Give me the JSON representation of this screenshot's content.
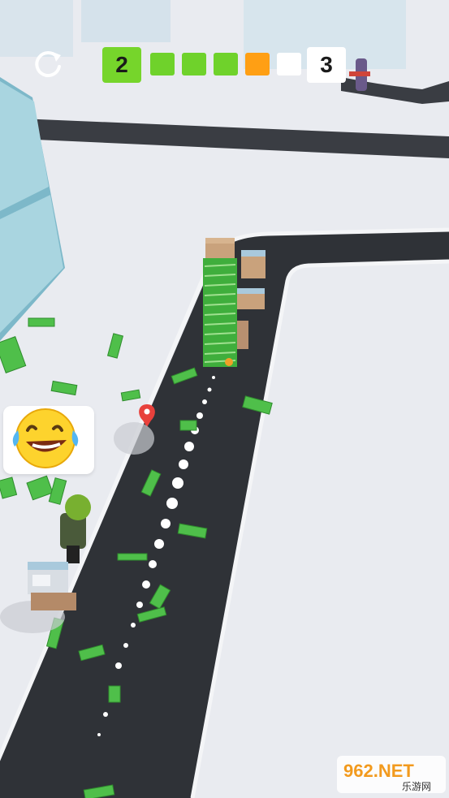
{
  "hud": {
    "restart_icon": "restart-icon",
    "current_level": "2",
    "next_level": "3",
    "progress_segments": [
      {
        "state": "done",
        "color": "#6fd22b"
      },
      {
        "state": "done",
        "color": "#6fd22b"
      },
      {
        "state": "done",
        "color": "#6fd22b"
      },
      {
        "state": "current",
        "color": "#ff9f14"
      },
      {
        "state": "upcoming",
        "color": "#ffffff"
      }
    ]
  },
  "scene": {
    "emoji": "laughing-tears-emoji",
    "marker": "map-pin-icon",
    "player": "courier-character",
    "stack": "money-stack"
  },
  "watermark": {
    "brand": "962.NET",
    "subtitle": "乐游网"
  },
  "colors": {
    "road": "#2f3237",
    "ground": "#e9ebf0",
    "accent_green": "#6fd22b",
    "accent_orange": "#ff9f14"
  }
}
